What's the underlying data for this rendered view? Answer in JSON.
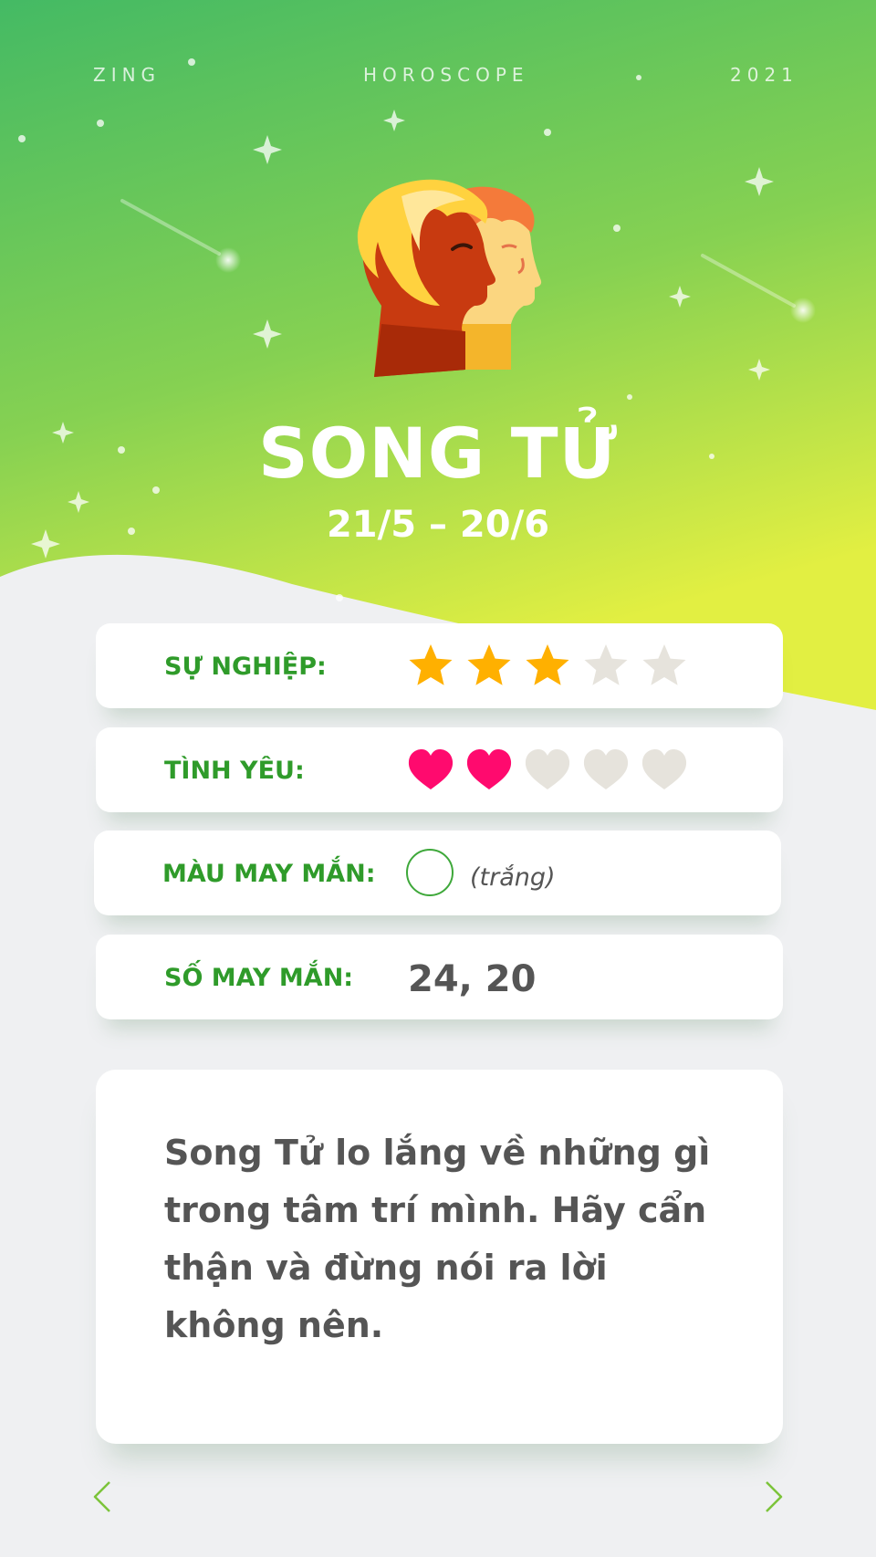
{
  "header": {
    "brand": "ZING",
    "section": "HOROSCOPE",
    "year": "2021"
  },
  "sign": {
    "name": "SONG TỬ",
    "dates": "21/5 – 20/6",
    "icon": "twin-heads-icon"
  },
  "ratings": {
    "career": {
      "label": "SỰ NGHIỆP:",
      "value": 3,
      "max": 5,
      "icon": "star-icon"
    },
    "love": {
      "label": "TÌNH YÊU:",
      "value": 2,
      "max": 5,
      "icon": "heart-icon"
    }
  },
  "lucky_color": {
    "label": "MÀU MAY MẮN:",
    "name": "(trắng)",
    "swatch": "#ffffff"
  },
  "lucky_number": {
    "label": "SỐ MAY MẮN:",
    "value": "24, 20"
  },
  "description": "Song Tử lo lắng về những gì trong tâm trí mình. Hãy cẩn thận và đừng nói ra lời không nên.",
  "colors": {
    "accent_green": "#2f9b2a",
    "star_filled": "#ffb000",
    "heart_filled": "#ff0a6e",
    "empty_icon": "#e6e3dc",
    "hero_top": "#46bb62",
    "hero_bottom": "#dcee45"
  },
  "nav": {
    "prev_icon": "chevron-left-icon",
    "next_icon": "chevron-right-icon"
  }
}
